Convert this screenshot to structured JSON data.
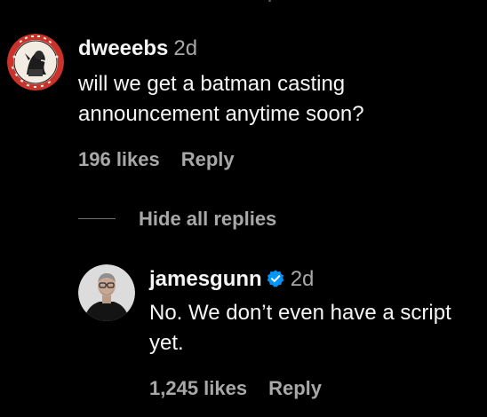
{
  "comments": [
    {
      "username": "dweeebs",
      "time": "2d",
      "text": "will we get a batman casting announcement anytime soon?",
      "likes": "196 likes",
      "reply_label": "Reply",
      "avatar": {
        "name": "circular-logo-badge",
        "badge_text_top": "INSANITY WITH",
        "badge_text_bottom": "THE BOX & CAT",
        "colors": {
          "ring": "#c9332b",
          "inner": "#f2ece2"
        }
      }
    },
    {
      "username": "jamesgunn",
      "verified": true,
      "time": "2d",
      "text": "No. We don’t even have a script yet.",
      "likes": "1,245 likes",
      "reply_label": "Reply",
      "avatar": {
        "name": "profile-photo"
      }
    }
  ],
  "hide_replies_label": "Hide all replies",
  "colors": {
    "background": "#000000",
    "primary_text": "#f5f5f5",
    "secondary_text": "#a8a8a8",
    "verified_badge": "#0095f6"
  }
}
